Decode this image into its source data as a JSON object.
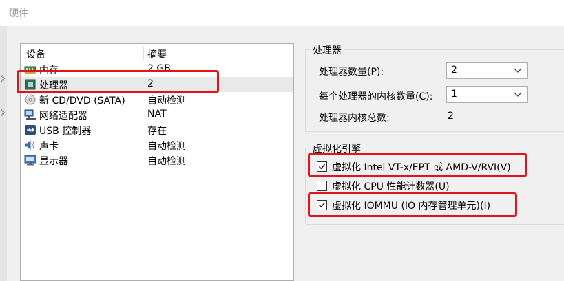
{
  "window": {
    "title": "硬件"
  },
  "edge_glyphs": [
    "》",
    "》"
  ],
  "device_list": {
    "header": {
      "device": "设备",
      "summary": "摘要"
    },
    "rows": [
      {
        "name": "内存",
        "summary": "2 GB",
        "icon": "memory-icon"
      },
      {
        "name": "处理器",
        "summary": "2",
        "icon": "processor-icon",
        "selected": true
      },
      {
        "name": "新 CD/DVD (SATA)",
        "summary": "自动检测",
        "icon": "cd-dvd-icon"
      },
      {
        "name": "网络适配器",
        "summary": "NAT",
        "icon": "network-adapter-icon"
      },
      {
        "name": "USB 控制器",
        "summary": "存在",
        "icon": "usb-icon"
      },
      {
        "name": "声卡",
        "summary": "自动检测",
        "icon": "sound-card-icon"
      },
      {
        "name": "显示器",
        "summary": "自动检测",
        "icon": "display-icon"
      }
    ]
  },
  "processor": {
    "group_label": "处理器",
    "count_label": "处理器数量(P):",
    "count_value": "2",
    "cores_label": "每个处理器的内核数量(C):",
    "cores_value": "1",
    "total_label": "处理器内核总数:",
    "total_value": "2"
  },
  "virtualization": {
    "group_label": "虚拟化引擎",
    "options": [
      {
        "label": "虚拟化 Intel VT-x/EPT 或 AMD-V/RVI(V)",
        "checked": true
      },
      {
        "label": "虚拟化 CPU 性能计数器(U)",
        "checked": false
      },
      {
        "label": "虚拟化 IOMMU (IO 内存管理单元)(I)",
        "checked": true
      }
    ]
  },
  "colors": {
    "highlight_red": "#e2131b",
    "dialog_bg": "#f0f0f0",
    "title_gray": "#9a9a9a"
  }
}
